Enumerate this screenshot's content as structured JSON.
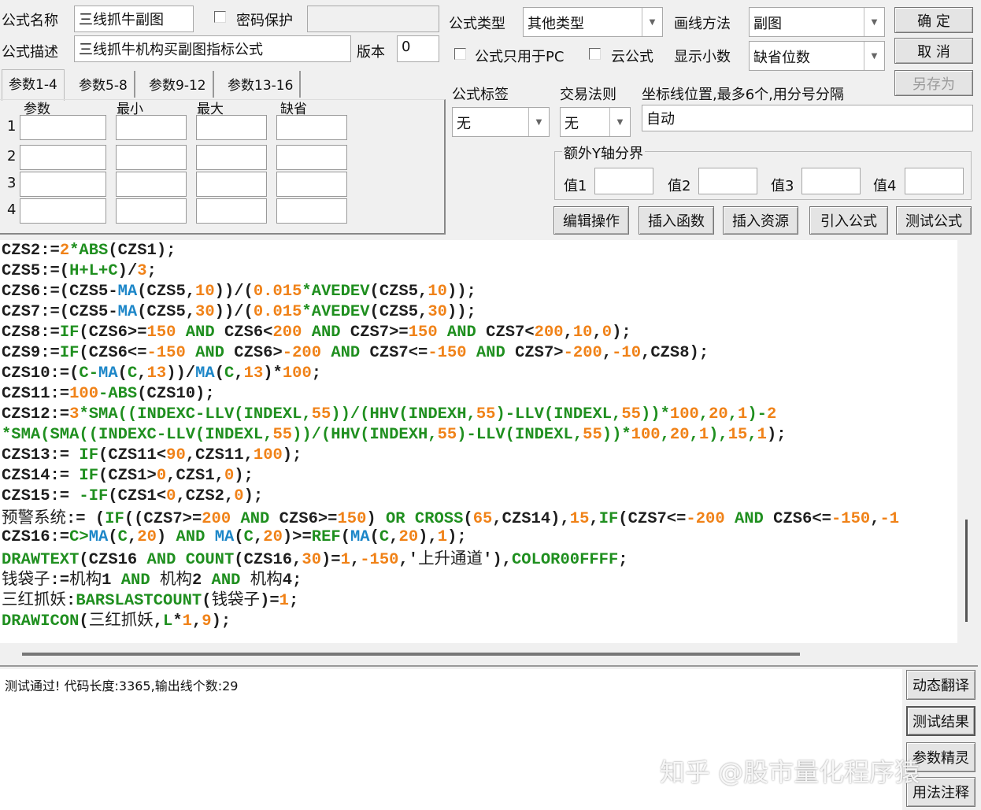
{
  "form": {
    "name_label": "公式名称",
    "name_value": "三线抓牛副图",
    "password_label": "密码保护",
    "password_value": "",
    "desc_label": "公式描述",
    "desc_value": "三线抓牛机构买副图指标公式",
    "version_label": "版本",
    "version_value": "0",
    "type_label": "公式类型",
    "type_value": "其他类型",
    "draw_label": "画线方法",
    "draw_value": "副图",
    "pc_only_label": "公式只用于PC",
    "cloud_label": "云公式",
    "decimals_label": "显示小数",
    "decimals_value": "缺省位数",
    "tag_label": "公式标签",
    "tag_value": "无",
    "trade_label": "交易法则",
    "trade_value": "无",
    "axis_label": "坐标线位置,最多6个,用分号分隔",
    "axis_value": "自动",
    "yaxis_group": "额外Y轴分界",
    "yvals": [
      "值1",
      "值2",
      "值3",
      "值4"
    ]
  },
  "buttons": {
    "ok": "确  定",
    "cancel": "取  消",
    "save_as": "另存为",
    "edit": "编辑操作",
    "insert_func": "插入函数",
    "insert_res": "插入资源",
    "import": "引入公式",
    "test": "测试公式"
  },
  "params": {
    "tabs": [
      "参数1-4",
      "参数5-8",
      "参数9-12",
      "参数13-16"
    ],
    "headers": [
      "参数",
      "最小",
      "最大",
      "缺省"
    ],
    "rows": [
      "1",
      "2",
      "3",
      "4"
    ]
  },
  "code": [
    [
      [
        "d",
        "CZS2:="
      ],
      [
        "n",
        "2"
      ],
      [
        "f",
        "*ABS"
      ],
      [
        "d",
        "(CZS1);"
      ]
    ],
    [
      [
        "d",
        "CZS5:=("
      ],
      [
        "f",
        "H+L+C"
      ],
      [
        "d",
        ")/"
      ],
      [
        "n",
        "3"
      ],
      [
        "d",
        ";"
      ]
    ],
    [
      [
        "d",
        "CZS6:=(CZS5-"
      ],
      [
        "b",
        "MA"
      ],
      [
        "d",
        "(CZS5,"
      ],
      [
        "n",
        "10"
      ],
      [
        "d",
        "))/("
      ],
      [
        "n",
        "0.015"
      ],
      [
        "f",
        "*AVEDEV"
      ],
      [
        "d",
        "(CZS5,"
      ],
      [
        "n",
        "10"
      ],
      [
        "d",
        "));"
      ]
    ],
    [
      [
        "d",
        "CZS7:=(CZS5-"
      ],
      [
        "b",
        "MA"
      ],
      [
        "d",
        "(CZS5,"
      ],
      [
        "n",
        "30"
      ],
      [
        "d",
        "))/("
      ],
      [
        "n",
        "0.015"
      ],
      [
        "f",
        "*AVEDEV"
      ],
      [
        "d",
        "(CZS5,"
      ],
      [
        "n",
        "30"
      ],
      [
        "d",
        "));"
      ]
    ],
    [
      [
        "d",
        "CZS8:="
      ],
      [
        "f",
        "IF"
      ],
      [
        "d",
        "(CZS6>="
      ],
      [
        "n",
        "150"
      ],
      [
        "f",
        " AND "
      ],
      [
        "d",
        "CZS6<"
      ],
      [
        "n",
        "200"
      ],
      [
        "f",
        " AND "
      ],
      [
        "d",
        "CZS7>="
      ],
      [
        "n",
        "150"
      ],
      [
        "f",
        " AND "
      ],
      [
        "d",
        "CZS7<"
      ],
      [
        "n",
        "200"
      ],
      [
        "d",
        ","
      ],
      [
        "n",
        "10"
      ],
      [
        "d",
        ","
      ],
      [
        "n",
        "0"
      ],
      [
        "d",
        ");"
      ]
    ],
    [
      [
        "d",
        "CZS9:="
      ],
      [
        "f",
        "IF"
      ],
      [
        "d",
        "(CZS6<="
      ],
      [
        "n",
        "-150"
      ],
      [
        "f",
        " AND "
      ],
      [
        "d",
        "CZS6>"
      ],
      [
        "n",
        "-200"
      ],
      [
        "f",
        " AND "
      ],
      [
        "d",
        "CZS7<="
      ],
      [
        "n",
        "-150"
      ],
      [
        "f",
        " AND "
      ],
      [
        "d",
        "CZS7>"
      ],
      [
        "n",
        "-200"
      ],
      [
        "d",
        ","
      ],
      [
        "n",
        "-10"
      ],
      [
        "d",
        ",CZS8);"
      ]
    ],
    [
      [
        "d",
        "CZS10:=("
      ],
      [
        "f",
        "C-"
      ],
      [
        "b",
        "MA"
      ],
      [
        "d",
        "("
      ],
      [
        "f",
        "C"
      ],
      [
        "d",
        ","
      ],
      [
        "n",
        "13"
      ],
      [
        "d",
        "))/"
      ],
      [
        "b",
        "MA"
      ],
      [
        "d",
        "("
      ],
      [
        "f",
        "C"
      ],
      [
        "d",
        ","
      ],
      [
        "n",
        "13"
      ],
      [
        "d",
        ")*"
      ],
      [
        "n",
        "100"
      ],
      [
        "d",
        ";"
      ]
    ],
    [
      [
        "d",
        "CZS11:="
      ],
      [
        "n",
        "100"
      ],
      [
        "f",
        "-ABS"
      ],
      [
        "d",
        "(CZS10);"
      ]
    ],
    [
      [
        "d",
        "CZS12:="
      ],
      [
        "n",
        "3"
      ],
      [
        "f",
        "*SMA((INDEXC-LLV(INDEXL,"
      ],
      [
        "n",
        "55"
      ],
      [
        "f",
        "))/(HHV(INDEXH,"
      ],
      [
        "n",
        "55"
      ],
      [
        "f",
        ")-LLV(INDEXL,"
      ],
      [
        "n",
        "55"
      ],
      [
        "f",
        "))*"
      ],
      [
        "n",
        "100"
      ],
      [
        "f",
        ","
      ],
      [
        "n",
        "20"
      ],
      [
        "f",
        ","
      ],
      [
        "n",
        "1"
      ],
      [
        "f",
        ")-"
      ],
      [
        "n",
        "2"
      ]
    ],
    [
      [
        "f",
        "*SMA(SMA((INDEXC-LLV(INDEXL,"
      ],
      [
        "n",
        "55"
      ],
      [
        "f",
        "))/(HHV(INDEXH,"
      ],
      [
        "n",
        "55"
      ],
      [
        "f",
        ")-LLV(INDEXL,"
      ],
      [
        "n",
        "55"
      ],
      [
        "f",
        "))*"
      ],
      [
        "n",
        "100"
      ],
      [
        "f",
        ","
      ],
      [
        "n",
        "20"
      ],
      [
        "f",
        ","
      ],
      [
        "n",
        "1"
      ],
      [
        "f",
        "),"
      ],
      [
        "n",
        "15"
      ],
      [
        "f",
        ","
      ],
      [
        "n",
        "1"
      ],
      [
        "d",
        ");"
      ]
    ],
    [
      [
        "d",
        "CZS13:= "
      ],
      [
        "f",
        "IF"
      ],
      [
        "d",
        "(CZS11<"
      ],
      [
        "n",
        "90"
      ],
      [
        "d",
        ",CZS11,"
      ],
      [
        "n",
        "100"
      ],
      [
        "d",
        ");"
      ]
    ],
    [
      [
        "d",
        "CZS14:= "
      ],
      [
        "f",
        "IF"
      ],
      [
        "d",
        "(CZS1>"
      ],
      [
        "n",
        "0"
      ],
      [
        "d",
        ",CZS1,"
      ],
      [
        "n",
        "0"
      ],
      [
        "d",
        ");"
      ]
    ],
    [
      [
        "d",
        "CZS15:= "
      ],
      [
        "f",
        "-IF"
      ],
      [
        "d",
        "(CZS1<"
      ],
      [
        "n",
        "0"
      ],
      [
        "d",
        ",CZS2,"
      ],
      [
        "n",
        "0"
      ],
      [
        "d",
        ");"
      ]
    ],
    [
      [
        "c",
        "预警系统"
      ],
      [
        "d",
        ":= ("
      ],
      [
        "f",
        "IF"
      ],
      [
        "d",
        "((CZS7>="
      ],
      [
        "n",
        "200"
      ],
      [
        "f",
        " AND "
      ],
      [
        "d",
        "CZS6>="
      ],
      [
        "n",
        "150"
      ],
      [
        "d",
        ") "
      ],
      [
        "f",
        "OR CROSS"
      ],
      [
        "d",
        "("
      ],
      [
        "n",
        "65"
      ],
      [
        "d",
        ",CZS14),"
      ],
      [
        "n",
        "15"
      ],
      [
        "d",
        ","
      ],
      [
        "f",
        "IF"
      ],
      [
        "d",
        "(CZS7<="
      ],
      [
        "n",
        "-200"
      ],
      [
        "f",
        " AND "
      ],
      [
        "d",
        "CZS6<="
      ],
      [
        "n",
        "-150"
      ],
      [
        "d",
        ","
      ],
      [
        "n",
        "-1"
      ]
    ],
    [
      [
        "d",
        "CZS16:="
      ],
      [
        "f",
        "C>"
      ],
      [
        "b",
        "MA"
      ],
      [
        "d",
        "("
      ],
      [
        "f",
        "C"
      ],
      [
        "d",
        ","
      ],
      [
        "n",
        "20"
      ],
      [
        "d",
        ")"
      ],
      [
        "f",
        " AND "
      ],
      [
        "b",
        "MA"
      ],
      [
        "d",
        "("
      ],
      [
        "f",
        "C"
      ],
      [
        "d",
        ","
      ],
      [
        "n",
        "20"
      ],
      [
        "d",
        ")>="
      ],
      [
        "f",
        "REF"
      ],
      [
        "d",
        "("
      ],
      [
        "b",
        "MA"
      ],
      [
        "d",
        "("
      ],
      [
        "f",
        "C"
      ],
      [
        "d",
        ","
      ],
      [
        "n",
        "20"
      ],
      [
        "d",
        "),"
      ],
      [
        "n",
        "1"
      ],
      [
        "d",
        ");"
      ]
    ],
    [
      [
        "f",
        "DRAWTEXT"
      ],
      [
        "d",
        "(CZS16 "
      ],
      [
        "f",
        "AND COUNT"
      ],
      [
        "d",
        "(CZS16,"
      ],
      [
        "n",
        "30"
      ],
      [
        "d",
        ")="
      ],
      [
        "n",
        "1"
      ],
      [
        "d",
        ","
      ],
      [
        "n",
        "-150"
      ],
      [
        "d",
        ",'"
      ],
      [
        "c",
        "上升通道"
      ],
      [
        "d",
        "'),"
      ],
      [
        "f",
        "COLOR00FFFF"
      ],
      [
        "d",
        ";"
      ]
    ],
    [
      [
        "c",
        "钱袋子"
      ],
      [
        "d",
        ":="
      ],
      [
        "c",
        "机构"
      ],
      [
        "d",
        "1 "
      ],
      [
        "f",
        "AND "
      ],
      [
        "c",
        "机构"
      ],
      [
        "d",
        "2 "
      ],
      [
        "f",
        "AND "
      ],
      [
        "c",
        "机构"
      ],
      [
        "d",
        "4;"
      ]
    ],
    [
      [
        "c",
        "三红抓妖"
      ],
      [
        "d",
        ":"
      ],
      [
        "f",
        "BARSLASTCOUNT"
      ],
      [
        "d",
        "("
      ],
      [
        "c",
        "钱袋子"
      ],
      [
        "d",
        ")="
      ],
      [
        "n",
        "1"
      ],
      [
        "d",
        ";"
      ]
    ],
    [
      [
        "f",
        "DRAWICON"
      ],
      [
        "d",
        "("
      ],
      [
        "c",
        "三红抓妖"
      ],
      [
        "d",
        ","
      ],
      [
        "f",
        "L"
      ],
      [
        "d",
        "*"
      ],
      [
        "n",
        "1"
      ],
      [
        "d",
        ","
      ],
      [
        "n",
        "9"
      ],
      [
        "d",
        ");"
      ]
    ]
  ],
  "status": {
    "message": "测试通过! 代码长度:3365,输出线个数:29"
  },
  "side_buttons": [
    "动态翻译",
    "测试结果",
    "参数精灵",
    "用法注释"
  ],
  "watermark": "知乎 @股市量化程序猿"
}
